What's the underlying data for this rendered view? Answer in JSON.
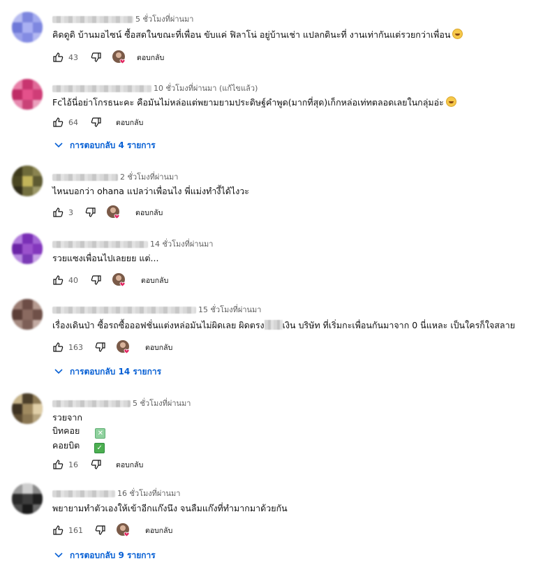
{
  "comments": [
    {
      "time": "5 ชั่วโมงที่ผ่านมา",
      "lines": [
        "คิดดูดิ บ้านมอไซน์ ซื้อสดในขณะที่เพื่อน ขับแค่ ฟิลาโน่ อยู่บ้านเช่า แปลกดินะที่ งานเท่ากันแต่รวยกว่าเพื่อน"
      ],
      "emoji": "laugh",
      "likes": "43",
      "reply": "ตอบกลับ"
    },
    {
      "time": "10 ชั่วโมงที่ผ่านมา (แก้ไขแล้ว)",
      "lines": [
        "Fcไอ้นี่อย่าโกรธนะคะ คือมันไม่หล่อแต่พยามยามประดิษฐ์คำพูด(มากที่สุด)เก็กหล่อเท่ทตลอดเลยในกลุ่มอ่ะ"
      ],
      "emoji": "laugh",
      "likes": "64",
      "reply": "ตอบกลับ",
      "replies": "การตอบกลับ 4 รายการ"
    },
    {
      "time": "2 ชั่วโมงที่ผ่านมา",
      "lines": [
        "ไหนบอกว่า ohana แปลว่าเพื่อนไง พี่แม่งทำงี้ได้ไงวะ"
      ],
      "likes": "3",
      "reply": "ตอบกลับ"
    },
    {
      "time": "14 ชั่วโมงที่ผ่านมา",
      "lines": [
        "รวยแซงเพื่อนไปเลยยย แต่..."
      ],
      "likes": "40",
      "reply": "ตอบกลับ"
    },
    {
      "time": "15 ชั่วโมงที่ผ่านมา",
      "line_pre": "เรื่องเดินป่า ซื้อรถซื้อออฟชั่นแต่งหล่อมันไม่ผิดเลย ผิดตรง",
      "line_post": "เงิน บริษัท ที่เริ่มกะเพื่อนกันมาจาก 0 นี่แหละ เป็นใครก็ใจสลาย",
      "likes": "163",
      "reply": "ตอบกลับ",
      "replies": "การตอบกลับ 14 รายการ"
    },
    {
      "time": "5 ชั่วโมงที่ผ่านมา",
      "lines": [
        "รวยจาก",
        "บิทคอย",
        "คอยบิต"
      ],
      "likes": "16",
      "reply": "ตอบกลับ"
    },
    {
      "time": "16 ชั่วโมงที่ผ่านมา",
      "lines": [
        "พยายามทำตัวเองให้เข้าอีกแก๊งนึง จนลืมแก๊งที่ทำมากมาด้วยกัน"
      ],
      "likes": "161",
      "reply": "ตอบกลับ",
      "replies": "การตอบกลับ 9 รายการ"
    }
  ],
  "colors": {
    "link": "#065fd4",
    "meta": "#606060",
    "text": "#0f0f0f",
    "heart": "#e0245e"
  }
}
